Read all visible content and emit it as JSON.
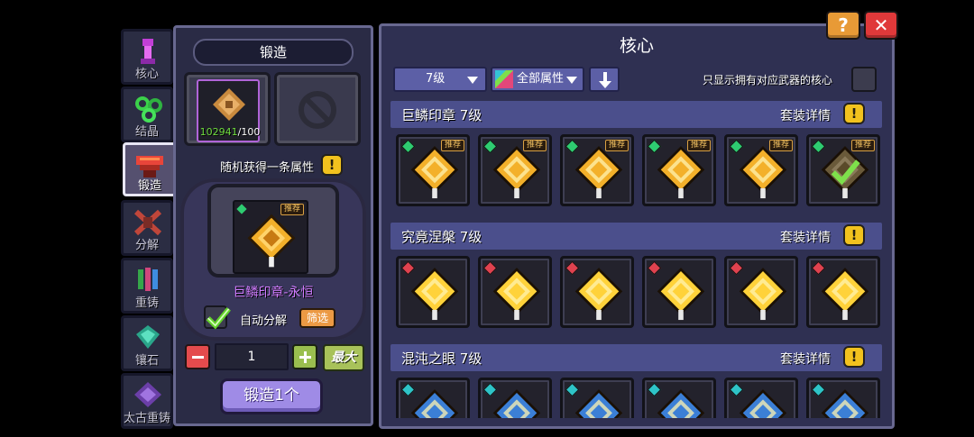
{
  "tabs": [
    {
      "label": "核心",
      "icon": "core-icon",
      "active": false
    },
    {
      "label": "结晶",
      "icon": "crystal-icon",
      "active": false
    },
    {
      "label": "锻造",
      "icon": "forge-icon",
      "active": true
    },
    {
      "label": "分解",
      "icon": "decompose-icon",
      "active": false
    },
    {
      "label": "重铸",
      "icon": "recast-icon",
      "active": false
    },
    {
      "label": "镶石",
      "icon": "inlay-icon",
      "active": false
    },
    {
      "label": "太古重铸",
      "icon": "ancient-recast-icon",
      "active": false
    }
  ],
  "forge": {
    "title": "锻造",
    "material_have": "102941",
    "material_need": "/100",
    "random_attr_label": "随机获得一条属性",
    "info_label": "!",
    "recommend_badge": "推荐",
    "result_name": "巨鳞印章-永恒",
    "auto_decompose_label": "自动分解",
    "auto_decompose_checked": true,
    "filter_label": "筛选",
    "quantity": "1",
    "max_label": "最大",
    "forge_button": "锻造1个"
  },
  "core": {
    "title": "核心",
    "level_select": "7级",
    "attr_select": "全部属性",
    "only_show_label": "只显示拥有对应武器的核心",
    "set_detail_label": "套装详情",
    "info_label": "!",
    "recommend_badge": "推荐",
    "sections": [
      {
        "title": "巨鳞印章 7级",
        "color": "#f3b02a",
        "element": "#2ecc71",
        "cards": 6,
        "recommended": [
          true,
          true,
          true,
          true,
          true,
          true
        ],
        "owned_checked_index": 5
      },
      {
        "title": "究竟涅槃 7级",
        "color": "#ffd23a",
        "element": "#e0424f",
        "cards": 6,
        "recommended": [
          false,
          false,
          false,
          false,
          false,
          false
        ],
        "owned_checked_index": -1
      },
      {
        "title": "混沌之眼 7级",
        "color": "#3b7fd6",
        "element": "#2ec4c8",
        "cards": 6,
        "recommended": [
          false,
          false,
          false,
          false,
          false,
          false
        ],
        "owned_checked_index": -1
      }
    ]
  },
  "top_buttons": {
    "help": "?",
    "close": "✕"
  }
}
